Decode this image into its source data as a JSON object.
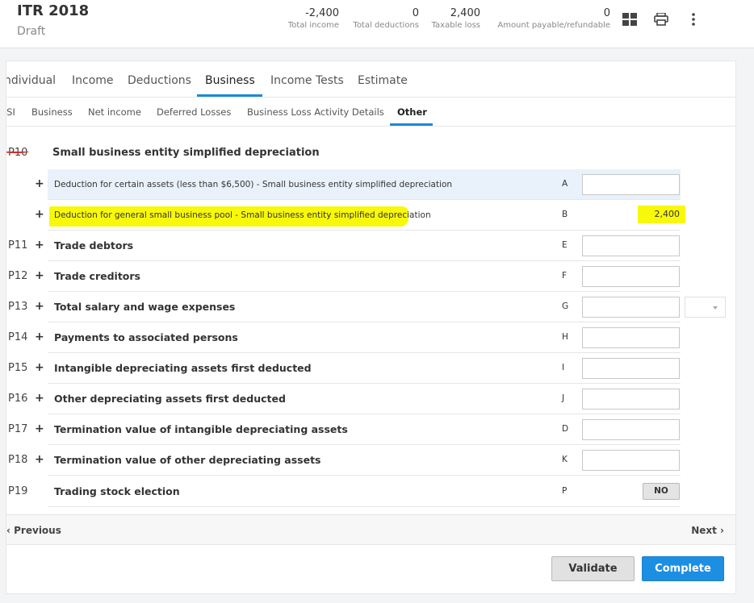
{
  "header": {
    "title": "ITR 2018",
    "status": "Draft",
    "stats": [
      {
        "value": "-2,400",
        "label": "Total income"
      },
      {
        "value": "0",
        "label": "Total deductions"
      },
      {
        "value": "2,400",
        "label": "Taxable loss"
      },
      {
        "value": "0",
        "label": "Amount payable/refundable"
      }
    ],
    "icons": [
      "grid-icon",
      "print-icon",
      "more-vertical-icon"
    ]
  },
  "tabs": [
    {
      "label": "ndividual"
    },
    {
      "label": "Income"
    },
    {
      "label": "Deductions"
    },
    {
      "label": "Business",
      "active": true
    },
    {
      "label": "Income Tests"
    },
    {
      "label": "Estimate"
    }
  ],
  "subtabs": [
    {
      "label": "'SI"
    },
    {
      "label": "Business"
    },
    {
      "label": "Net income"
    },
    {
      "label": "Deferred Losses"
    },
    {
      "label": "Business Loss Activity Details"
    },
    {
      "label": "Other",
      "active": true
    }
  ],
  "section": {
    "code": "P10",
    "title": "Small business entity simplified depreciation"
  },
  "rows": [
    {
      "code": "",
      "label": "Deduction for certain assets (less than $6,500) - Small business entity simplified depreciation",
      "letter": "A",
      "value": ""
    },
    {
      "code": "",
      "label": "Deduction for general small business pool - Small business entity simplified depreciation",
      "letter": "B",
      "value": "2,400"
    },
    {
      "code": "P11",
      "label": "Trade debtors",
      "letter": "E",
      "value": ""
    },
    {
      "code": "P12",
      "label": "Trade creditors",
      "letter": "F",
      "value": ""
    },
    {
      "code": "P13",
      "label": "Total salary and wage expenses",
      "letter": "G",
      "value": ""
    },
    {
      "code": "P14",
      "label": "Payments to associated persons",
      "letter": "H",
      "value": ""
    },
    {
      "code": "P15",
      "label": "Intangible depreciating assets first deducted",
      "letter": "I",
      "value": ""
    },
    {
      "code": "P16",
      "label": "Other depreciating assets first deducted",
      "letter": "J",
      "value": ""
    },
    {
      "code": "P17",
      "label": "Termination value of intangible depreciating assets",
      "letter": "D",
      "value": ""
    },
    {
      "code": "P18",
      "label": "Termination value of other depreciating assets",
      "letter": "K",
      "value": ""
    },
    {
      "code": "P19",
      "label": "Trading stock election",
      "letter": "P",
      "value": "NO"
    }
  ],
  "pager": {
    "prev": "Previous",
    "next": "Next"
  },
  "actions": {
    "validate": "Validate",
    "complete": "Complete"
  },
  "colors": {
    "accent": "#1c8ad8",
    "highlight": "#f8f80a",
    "annotation": "#d32a2a"
  }
}
